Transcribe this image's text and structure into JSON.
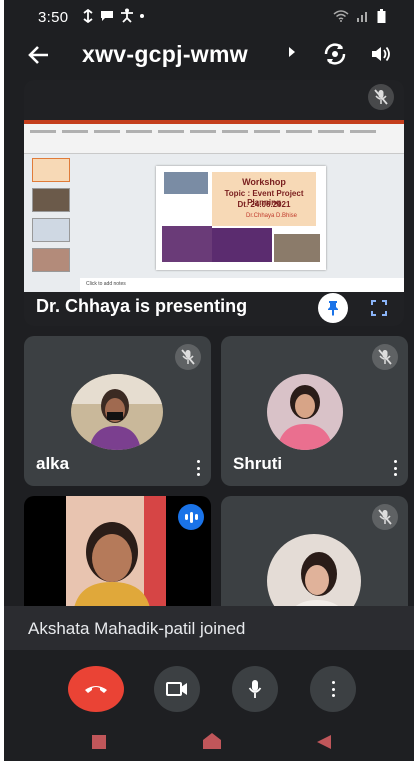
{
  "status_bar": {
    "time": "3:50",
    "icons": [
      "sync-icon",
      "message-icon",
      "accessibility-icon",
      "dot-icon",
      "wifi-icon",
      "signal-icon",
      "battery-icon"
    ]
  },
  "app_bar": {
    "meeting_code": "xwv-gcpj-wmw",
    "icons": [
      "back-arrow-icon",
      "caret-right-icon",
      "switch-camera-icon",
      "speaker-icon"
    ]
  },
  "presentation": {
    "caption": "Dr. Chhaya is presenting",
    "slide": {
      "line1": "Workshop",
      "line2": "Topic : Event Project Planning",
      "line3": "Dt. 24.06.2021",
      "line4": "Dr.Chhaya D.Bhise"
    },
    "notes_hint": "Click to add notes",
    "icons": [
      "mic-off-icon",
      "pin-icon",
      "fullscreen-icon"
    ]
  },
  "participants": [
    {
      "name": "alka",
      "muted": true
    },
    {
      "name": "Shruti",
      "muted": true
    },
    {
      "name": "",
      "speaking": true
    },
    {
      "name": "",
      "muted": true
    }
  ],
  "toast": {
    "message": "Akshata Mahadik-patil joined"
  },
  "controls": {
    "icons": [
      "end-call-icon",
      "camera-icon",
      "mic-icon",
      "more-vertical-icon"
    ]
  },
  "colors": {
    "end_call": "#ea4335",
    "tile_bg": "#3c4043",
    "screen_bg": "#1e1f22",
    "speaking_badge": "#1a73e8"
  }
}
